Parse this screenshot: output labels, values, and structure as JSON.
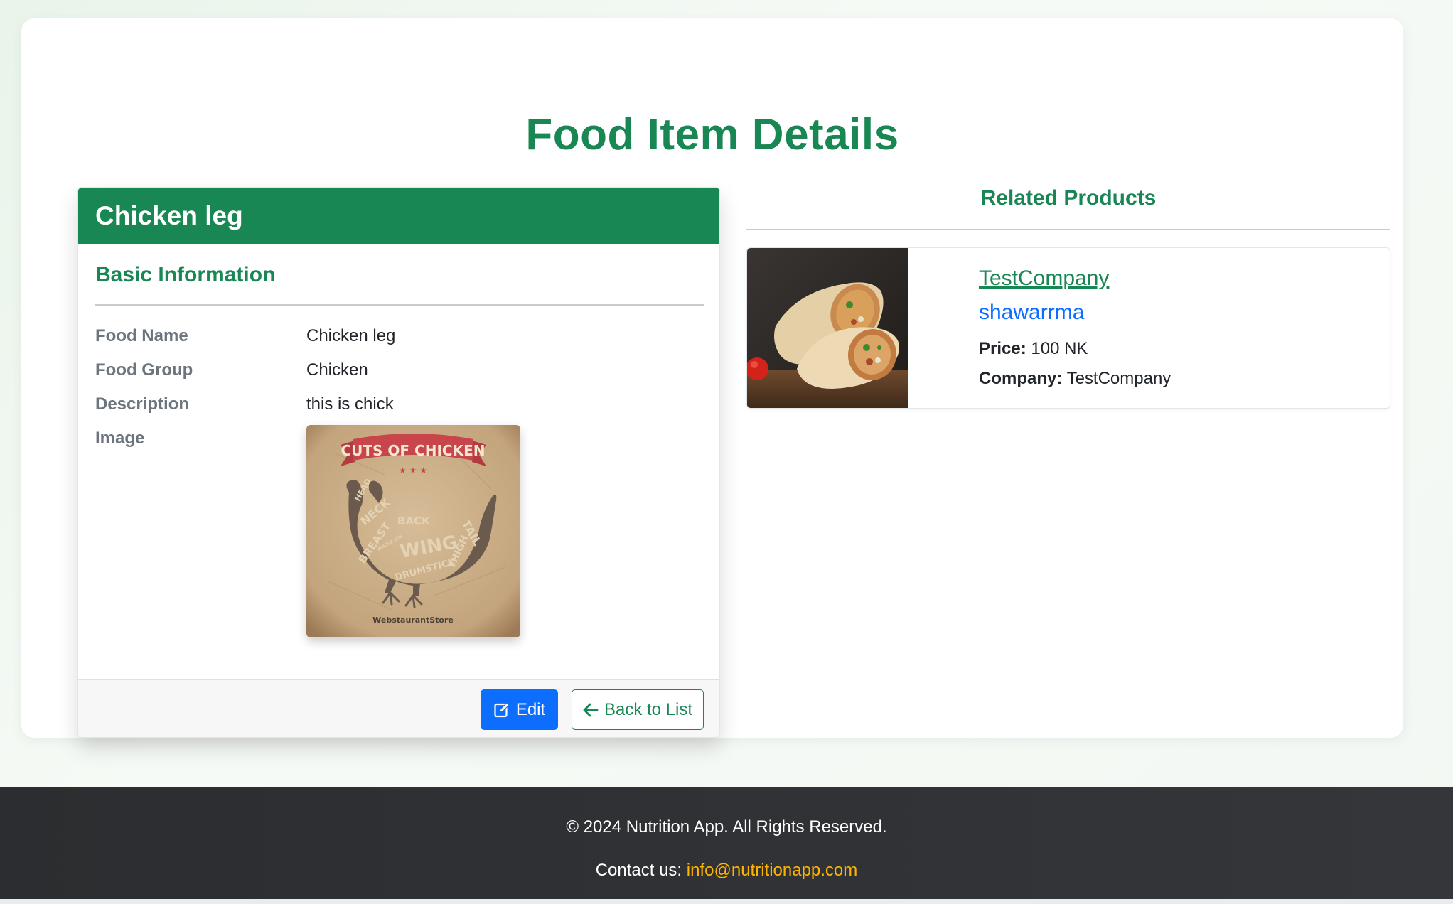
{
  "page": {
    "title": "Food Item Details"
  },
  "food": {
    "header_name": "Chicken leg",
    "section_title": "Basic Information",
    "rows": [
      {
        "label": "Food Name",
        "value": "Chicken leg"
      },
      {
        "label": "Food Group",
        "value": "Chicken"
      },
      {
        "label": "Description",
        "value": "this is chick"
      },
      {
        "label": "Image",
        "value": ""
      }
    ],
    "image": {
      "icon": "chicken-cuts-poster",
      "banner": "CUTS OF CHICKEN",
      "parts": [
        "HEAD",
        "NECK",
        "BACK",
        "TAIL",
        "BREAST",
        "WING",
        "THIGH",
        "DRUMSTICK",
        "WHOLE LEG"
      ],
      "brand": "WebstaurantStore"
    },
    "actions": {
      "edit_label": "Edit",
      "back_label": "Back to List"
    }
  },
  "related": {
    "title": "Related Products",
    "products": [
      {
        "company_link": "TestCompany",
        "name": "shawarrma",
        "price_label": "Price:",
        "price_value": "100 NK",
        "company_label": "Company:",
        "company_value": "TestCompany",
        "image_icon": "shawarma-photo"
      }
    ]
  },
  "footer": {
    "copyright": "© 2024 Nutrition App. All Rights Reserved.",
    "contact_label": "Contact us:",
    "contact_email": "info@nutritionapp.com"
  },
  "colors": {
    "brand_green": "#198754",
    "primary_blue": "#0d6efd",
    "link_orange": "#ffb400",
    "footer_dark": "#2f3134"
  }
}
